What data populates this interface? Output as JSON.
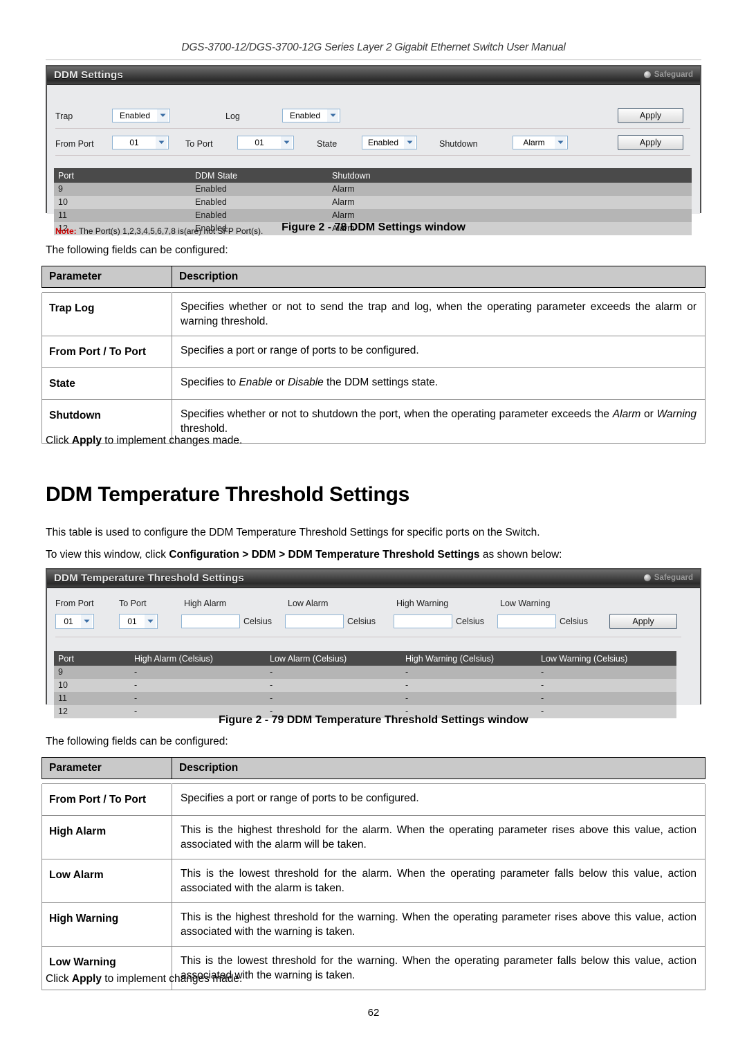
{
  "document": {
    "running_header": "DGS-3700-12/DGS-3700-12G Series Layer 2 Gigabit Ethernet Switch User Manual",
    "page_number": "62"
  },
  "window1": {
    "title": "DDM Settings",
    "safeguard_label": "Safeguard",
    "row1": {
      "trap_label": "Trap",
      "trap_value": "Enabled",
      "log_label": "Log",
      "log_value": "Enabled",
      "apply_label": "Apply"
    },
    "row2": {
      "from_port_label": "From Port",
      "from_port_value": "01",
      "to_port_label": "To Port",
      "to_port_value": "01",
      "state_label": "State",
      "state_value": "Enabled",
      "shutdown_label": "Shutdown",
      "shutdown_value": "Alarm",
      "apply_label": "Apply"
    },
    "grid": {
      "columns": [
        "Port",
        "DDM State",
        "Shutdown"
      ],
      "rows": [
        [
          "9",
          "Enabled",
          "Alarm"
        ],
        [
          "10",
          "Enabled",
          "Alarm"
        ],
        [
          "11",
          "Enabled",
          "Alarm"
        ],
        [
          "12",
          "Enabled",
          "Alarm"
        ]
      ]
    },
    "note_prefix": "Note:",
    "note_text": " The Port(s) 1,2,3,4,5,6,7,8 is(are) not SFP Port(s)."
  },
  "figure1": {
    "caption": "Figure 2 - 78 DDM Settings window"
  },
  "intro1": "The following fields can be configured:",
  "table1": {
    "headers": [
      "Parameter",
      "Description"
    ],
    "rows": [
      {
        "parameter": "Trap Log",
        "description": "Specifies whether or not to send the trap and log, when the operating parameter exceeds the alarm or warning threshold."
      },
      {
        "parameter": "From Port / To Port",
        "description": "Specifies a port or range of ports to be configured."
      },
      {
        "parameter": "State",
        "description_pre": "Specifies to ",
        "description_em1": "Enable",
        "description_mid": " or ",
        "description_em2": "Disable",
        "description_post": " the DDM settings state."
      },
      {
        "parameter": "Shutdown",
        "description_pre": "Specifies whether or not to shutdown the port, when the operating parameter exceeds the ",
        "description_em1": "Alarm",
        "description_mid": " or ",
        "description_em2": "Warning",
        "description_post": " threshold."
      }
    ]
  },
  "apply_note1": {
    "pre": "Click ",
    "bold": "Apply",
    "post": " to implement changes made."
  },
  "section": {
    "heading": "DDM Temperature Threshold Settings",
    "paragraph": "This table is used to configure the DDM Temperature Threshold Settings for specific ports on the Switch.",
    "nav_pre": "To view this window, click ",
    "nav_path": "Configuration > DDM > DDM Temperature Threshold Settings",
    "nav_post": " as shown below:"
  },
  "window2": {
    "title": "DDM Temperature Threshold Settings",
    "safeguard_label": "Safeguard",
    "form": {
      "from_port_label": "From Port",
      "from_port_value": "01",
      "to_port_label": "To Port",
      "to_port_value": "01",
      "high_alarm_label": "High Alarm",
      "high_alarm_value": "",
      "high_alarm_unit": "Celsius",
      "low_alarm_label": "Low Alarm",
      "low_alarm_value": "",
      "low_alarm_unit": "Celsius",
      "high_warning_label": "High Warning",
      "high_warning_value": "",
      "high_warning_unit": "Celsius",
      "low_warning_label": "Low Warning",
      "low_warning_value": "",
      "low_warning_unit": "Celsius",
      "apply_label": "Apply"
    },
    "grid": {
      "columns": [
        "Port",
        "High Alarm (Celsius)",
        "Low Alarm (Celsius)",
        "High Warning (Celsius)",
        "Low Warning (Celsius)"
      ],
      "rows": [
        [
          "9",
          "-",
          "-",
          "-",
          "-"
        ],
        [
          "10",
          "-",
          "-",
          "-",
          "-"
        ],
        [
          "11",
          "-",
          "-",
          "-",
          "-"
        ],
        [
          "12",
          "-",
          "-",
          "-",
          "-"
        ]
      ]
    }
  },
  "figure2": {
    "caption": "Figure 2 - 79 DDM Temperature Threshold Settings window"
  },
  "intro2": "The following fields can be configured:",
  "table2": {
    "headers": [
      "Parameter",
      "Description"
    ],
    "rows": [
      {
        "parameter": "From Port / To Port",
        "description": "Specifies a port or range of ports to be configured."
      },
      {
        "parameter": "High Alarm",
        "description": "This is the highest threshold for the alarm. When the operating parameter rises above this value, action associated with the alarm will be taken."
      },
      {
        "parameter": "Low Alarm",
        "description": "This is the lowest threshold for the alarm. When the operating parameter falls below this value, action associated with the alarm is taken."
      },
      {
        "parameter": "High Warning",
        "description": "This is the highest threshold for the warning. When the operating parameter rises above this value, action associated with the warning is taken."
      },
      {
        "parameter": "Low Warning",
        "description": "This is the lowest threshold for the warning. When the operating parameter falls below this value, action associated with the warning is taken."
      }
    ]
  },
  "apply_note2": {
    "pre": "Click ",
    "bold": "Apply",
    "post": " to implement changes made."
  }
}
